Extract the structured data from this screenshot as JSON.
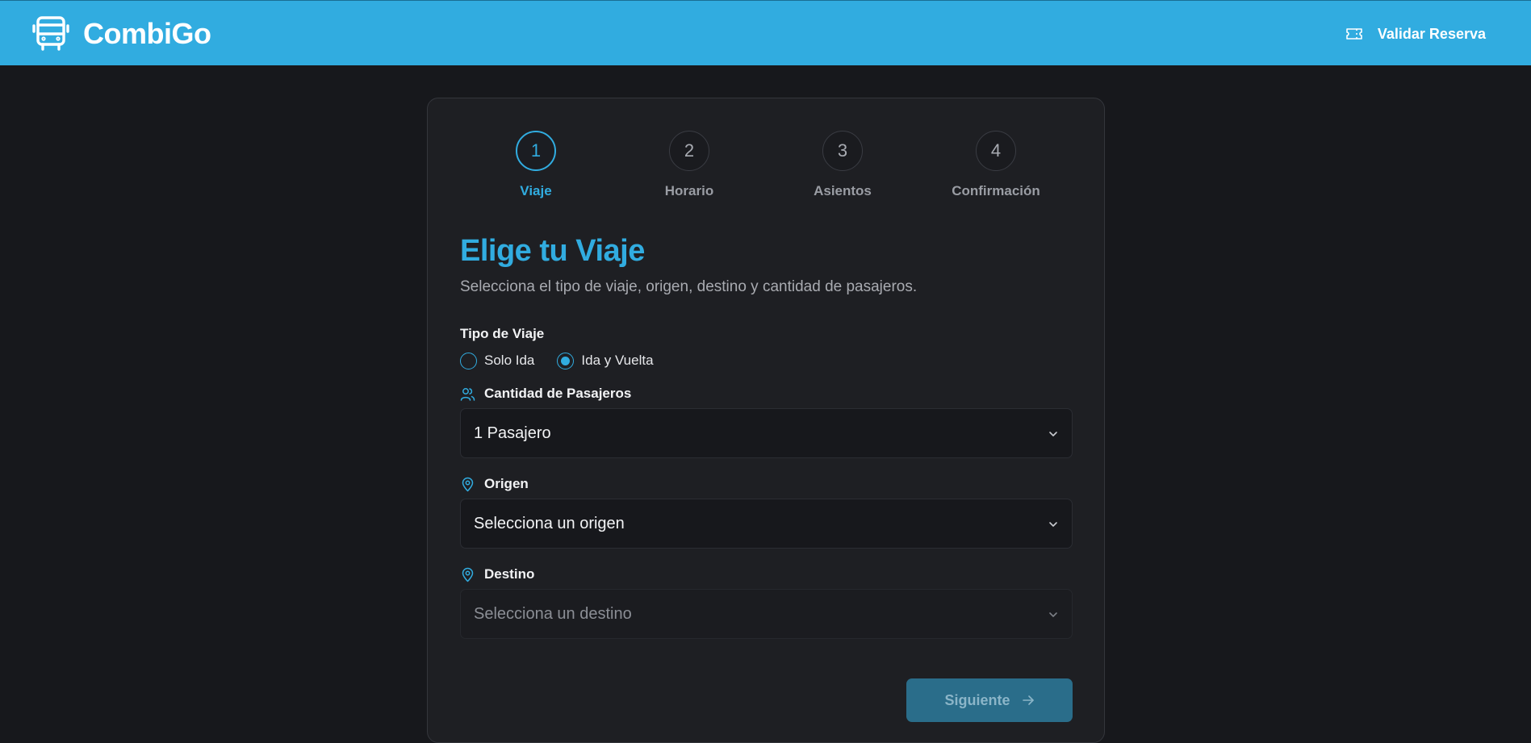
{
  "header": {
    "brand_name": "CombiGo",
    "brand_icon": "bus-icon",
    "validate_label": "Validar Reserva",
    "validate_icon": "ticket-icon"
  },
  "steps": [
    {
      "number": "1",
      "label": "Viaje",
      "active": true
    },
    {
      "number": "2",
      "label": "Horario",
      "active": false
    },
    {
      "number": "3",
      "label": "Asientos",
      "active": false
    },
    {
      "number": "4",
      "label": "Confirmación",
      "active": false
    }
  ],
  "form": {
    "title": "Elige tu Viaje",
    "subtitle": "Selecciona el tipo de viaje, origen, destino y cantidad de pasajeros.",
    "trip_type": {
      "label": "Tipo de Viaje",
      "options": [
        {
          "label": "Solo Ida",
          "selected": false
        },
        {
          "label": "Ida y Vuelta",
          "selected": true
        }
      ]
    },
    "passengers": {
      "label": "Cantidad de Pasajeros",
      "value": "1 Pasajero",
      "icon": "users-icon"
    },
    "origin": {
      "label": "Origen",
      "value": "Selecciona un origen",
      "icon": "map-pin-icon"
    },
    "destination": {
      "label": "Destino",
      "value": "Selecciona un destino",
      "icon": "map-pin-icon",
      "disabled": true
    },
    "next_label": "Siguiente"
  },
  "colors": {
    "accent": "#31ace0",
    "background": "#17181c",
    "card": "#1e1f23"
  }
}
